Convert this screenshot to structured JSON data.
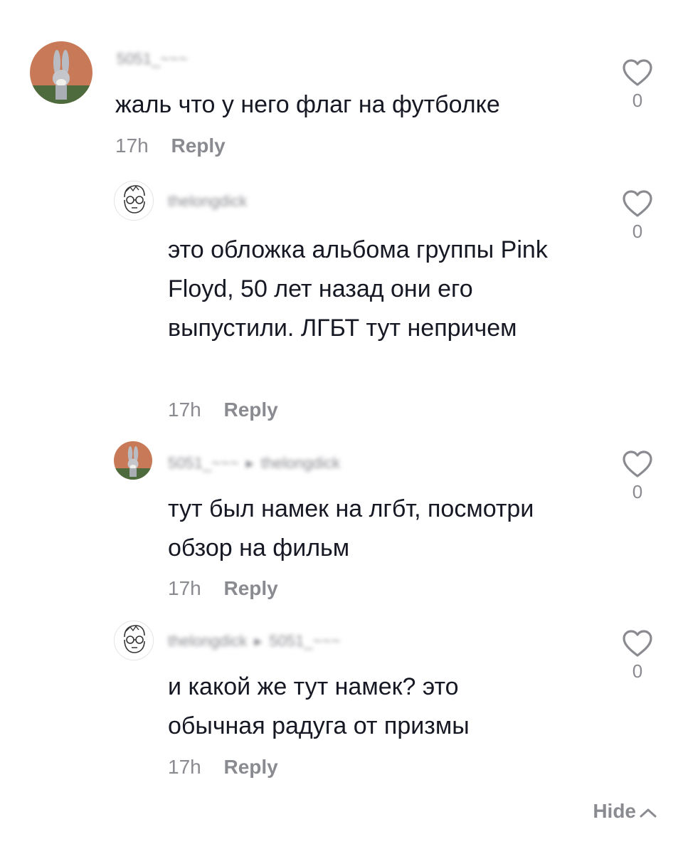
{
  "comments": [
    {
      "username": "5051_~~~",
      "text": "жаль что у него флаг на футболке",
      "time": "17h",
      "reply_label": "Reply",
      "likes": "0",
      "avatar": "bunny-avatar"
    },
    {
      "username": "thelongdick",
      "text": "это обложка альбома группы Pink Floyd, 50 лет назад они его выпустили. ЛГБТ тут непричем",
      "time": "17h",
      "reply_label": "Reply",
      "likes": "0",
      "avatar": "glasses-man-avatar"
    },
    {
      "username": "5051_~~~",
      "reply_to": "thelongdick",
      "text": "тут был намек на лгбт, посмотри обзор на фильм",
      "time": "17h",
      "reply_label": "Reply",
      "likes": "0",
      "avatar": "bunny-avatar"
    },
    {
      "username": "thelongdick",
      "reply_to": "5051_~~~",
      "text": "и какой же тут намек? это обычная радуга от призмы",
      "time": "17h",
      "reply_label": "Reply",
      "likes": "0",
      "avatar": "glasses-man-avatar"
    }
  ],
  "hide_label": "Hide",
  "colors": {
    "text": "#161823",
    "muted": "#8a8b91",
    "background": "#ffffff"
  }
}
